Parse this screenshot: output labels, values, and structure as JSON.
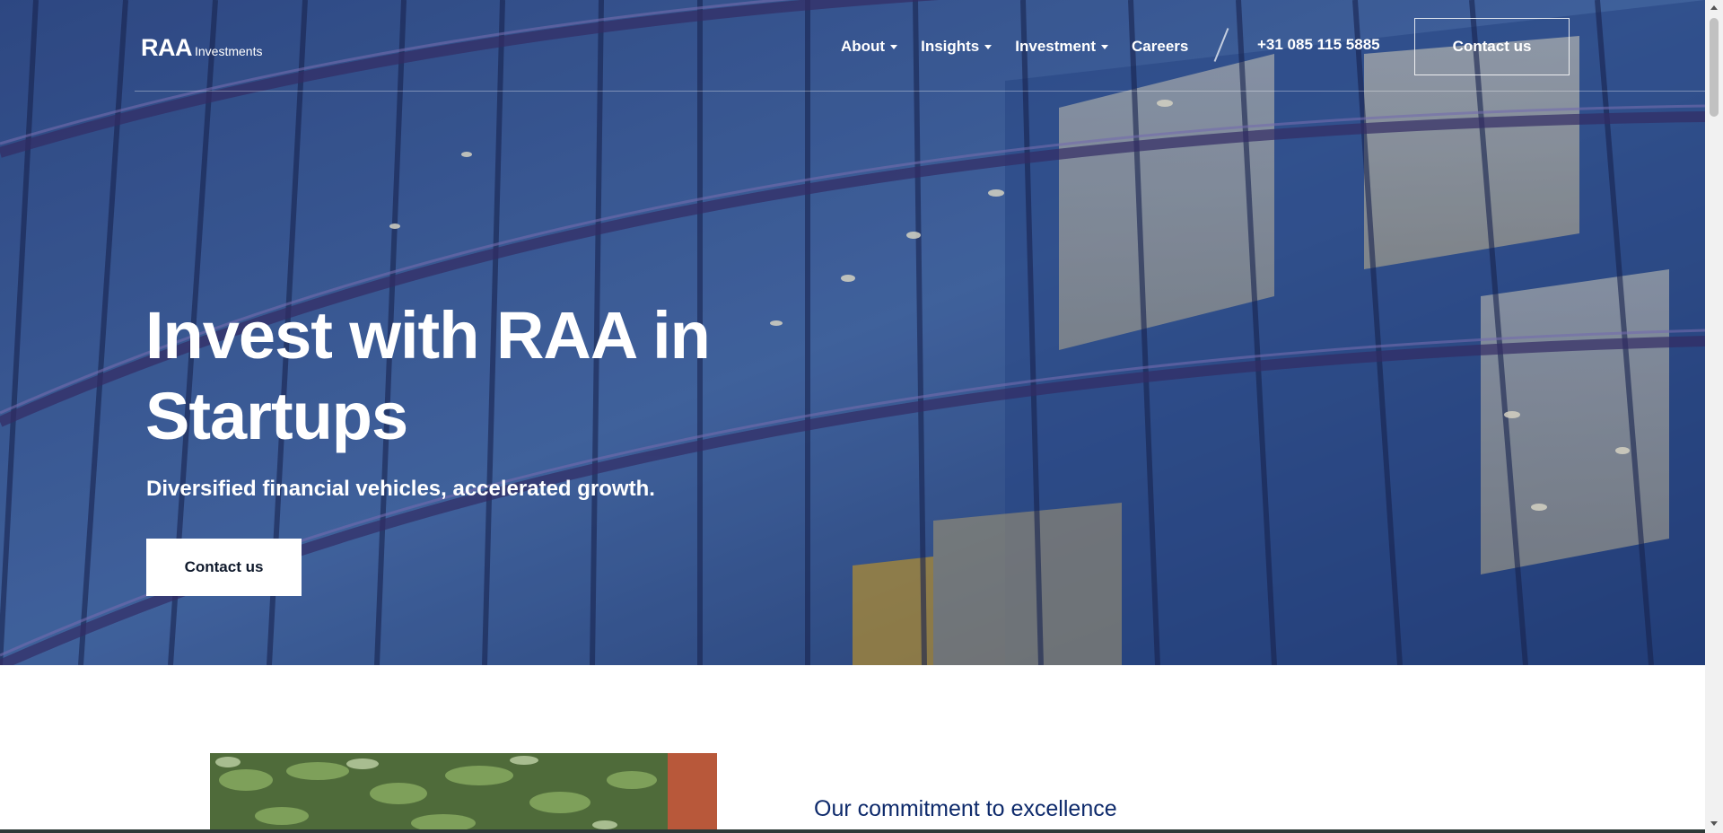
{
  "header": {
    "logo_main": "RAA",
    "logo_sub": "Investments",
    "nav": [
      {
        "label": "About",
        "has_dropdown": true
      },
      {
        "label": "Insights",
        "has_dropdown": true
      },
      {
        "label": "Investment",
        "has_dropdown": true
      },
      {
        "label": "Careers",
        "has_dropdown": false
      }
    ],
    "phone": "+31 085 115 5885",
    "cta": "Contact us"
  },
  "hero": {
    "title_line1": "Invest with RAA in",
    "title_line2": "Startups",
    "subtitle": "Diversified financial vehicles, accelerated growth.",
    "cta": "Contact us"
  },
  "section": {
    "heading": "Our commitment to excellence"
  },
  "icons": [
    "chevron-down-icon",
    "scroll-up-arrow-icon",
    "scroll-down-arrow-icon"
  ],
  "colors": {
    "heading_blue": "#0e2a6b",
    "hero_overlay": "#1d2d59",
    "white": "#ffffff"
  }
}
